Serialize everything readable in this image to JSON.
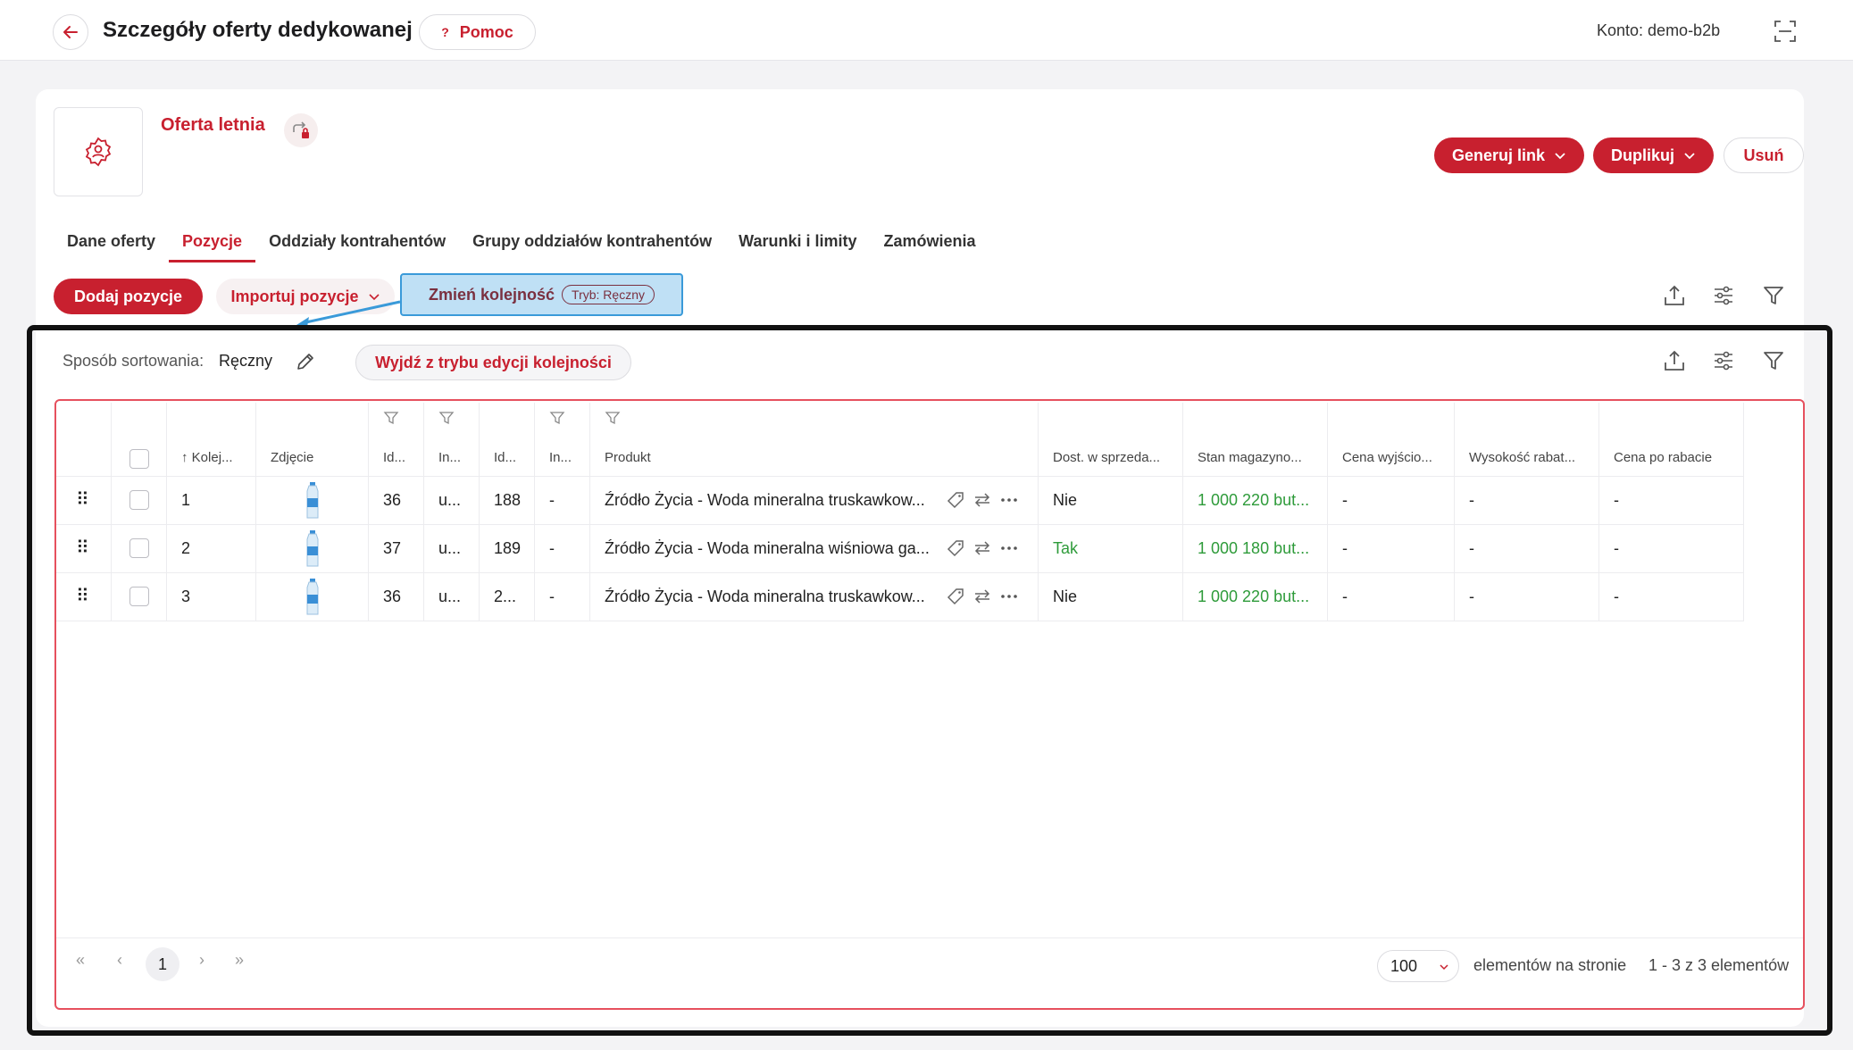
{
  "header": {
    "title": "Szczegóły oferty dedykowanej",
    "help_label": "Pomoc",
    "account_label": "Konto: demo-b2b"
  },
  "offer": {
    "name": "Oferta letnia"
  },
  "actions": {
    "generate_link": "Generuj link",
    "duplicate": "Duplikuj",
    "delete": "Usuń"
  },
  "tabs": [
    {
      "label": "Dane oferty"
    },
    {
      "label": "Pozycje"
    },
    {
      "label": "Oddziały kontrahentów"
    },
    {
      "label": "Grupy oddziałów kontrahentów"
    },
    {
      "label": "Warunki i limity"
    },
    {
      "label": "Zamówienia"
    }
  ],
  "toolbar": {
    "add_positions": "Dodaj pozycje",
    "import_positions": "Importuj pozycje",
    "change_order": "Zmień kolejność",
    "mode_badge": "Tryb: Ręczny"
  },
  "sorting": {
    "label": "Sposób sortowania:",
    "value": "Ręczny",
    "exit_button": "Wyjdź z trybu edycji kolejności"
  },
  "table": {
    "columns": [
      "Kolej...",
      "Zdjęcie",
      "Id...",
      "In...",
      "Id...",
      "In...",
      "Produkt",
      "Dost. w sprzeda...",
      "Stan magazyno...",
      "Cena wyjścio...",
      "Wysokość rabat...",
      "Cena po rabacie"
    ],
    "rows": [
      {
        "order": "1",
        "id1": "36",
        "in1": "u...",
        "id2": "188",
        "in2": "-",
        "product": "Źródło Życia - Woda mineralna truskawkow...",
        "available": "Nie",
        "stock": "1 000 220 but...",
        "base_price": "-",
        "discount": "-",
        "final_price": "-"
      },
      {
        "order": "2",
        "id1": "37",
        "in1": "u...",
        "id2": "189",
        "in2": "-",
        "product": "Źródło Życia - Woda mineralna wiśniowa ga...",
        "available": "Tak",
        "stock": "1 000 180 but...",
        "base_price": "-",
        "discount": "-",
        "final_price": "-"
      },
      {
        "order": "3",
        "id1": "36",
        "in1": "u...",
        "id2": "2...",
        "in2": "-",
        "product": "Źródło Życia - Woda mineralna truskawkow...",
        "available": "Nie",
        "stock": "1 000 220 but...",
        "base_price": "-",
        "discount": "-",
        "final_price": "-"
      }
    ]
  },
  "pagination": {
    "current_page": "1",
    "per_page": "100",
    "per_page_label": "elementów na stronie",
    "range_label": "1 - 3 z 3 elementów"
  },
  "colors": {
    "accent": "#c8202f",
    "success": "#2e9b3a",
    "highlight": "#3a9ad9"
  }
}
